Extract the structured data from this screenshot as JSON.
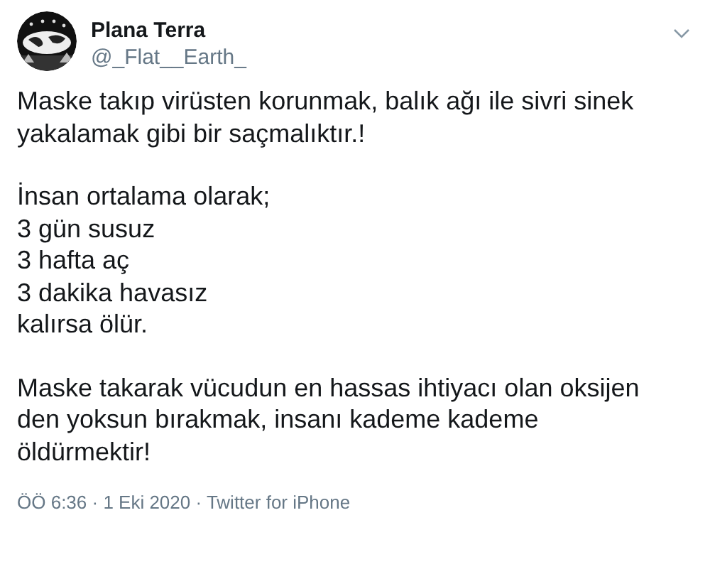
{
  "author": {
    "name": "Plana Terra",
    "handle": "@_Flat__Earth_"
  },
  "paragraphs": [
    [
      "Maske takıp virüsten korunmak, balık ağı ile sivri sinek",
      "yakalamak gibi bir saçmalıktır.!"
    ],
    [
      "İnsan ortalama olarak;",
      "3 gün susuz",
      "3 hafta aç",
      "3 dakika havasız",
      "kalırsa ölür."
    ],
    [
      "Maske takarak vücudun en hassas ihtiyacı olan oksijen",
      "den yoksun bırakmak, insanı kademe kademe",
      "öldürmektir!"
    ]
  ],
  "meta": "ÖÖ 6:36 · 1 Eki 2020 · Twitter for iPhone"
}
